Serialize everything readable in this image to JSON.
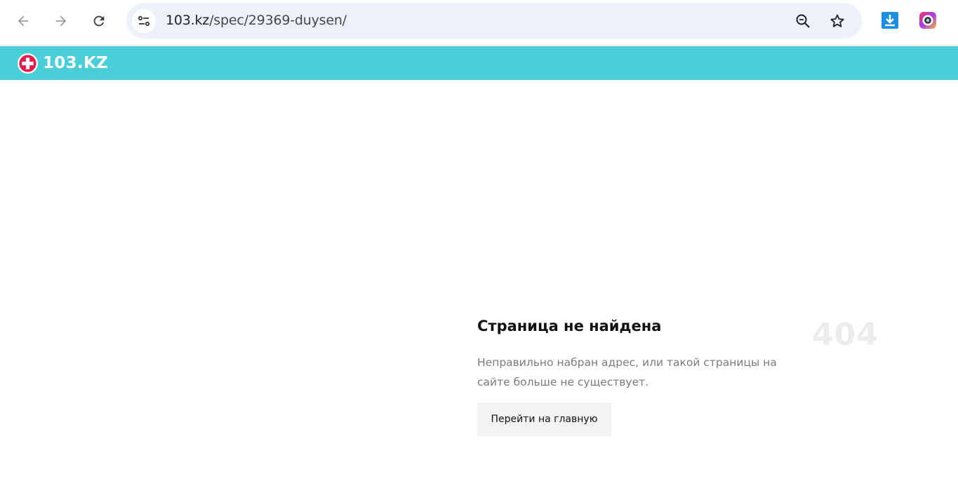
{
  "browser": {
    "url_host": "103.kz",
    "url_path": "/spec/29369-duysen/",
    "icons": {
      "back": "arrow-left-icon",
      "forward": "arrow-right-icon",
      "reload": "reload-icon",
      "site_info": "tune-icon",
      "zoom": "zoom-out-icon",
      "bookmark": "star-icon",
      "download_ext": "download-extension-icon",
      "camera_ext": "camera-extension-icon"
    }
  },
  "site": {
    "logo_text": "103.KZ",
    "header_color": "#4acfd9",
    "logo_mark_color": "#e8194c"
  },
  "error": {
    "title": "Страница не найдена",
    "code": "404",
    "description": "Неправильно набран адрес, или такой страницы на сайте больше не существует.",
    "home_button": "Перейти на главную"
  }
}
